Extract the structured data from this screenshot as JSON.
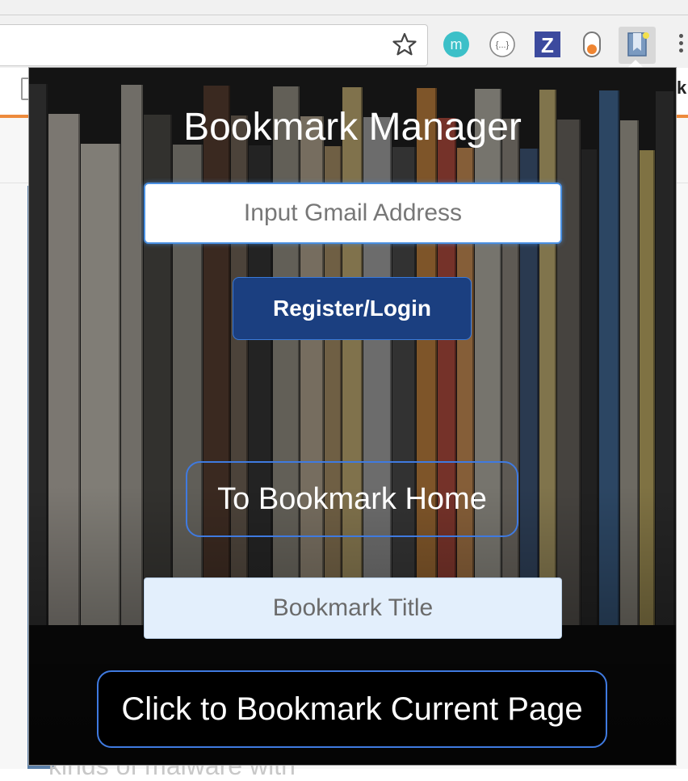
{
  "popup": {
    "title": "Bookmark Manager",
    "email_input": {
      "placeholder": "Input Gmail Address",
      "value": ""
    },
    "register_button": "Register/Login",
    "home_button": "To Bookmark Home",
    "bookmark_title_input": {
      "placeholder": "Bookmark Title",
      "value": ""
    },
    "bookmark_current_button": "Click to Bookmark Current Page"
  },
  "browser": {
    "page_letter": "k",
    "page_text": "kinds of malware with",
    "extensions": [
      "m-icon",
      "json-viewer-icon",
      "z-icon",
      "pill-icon",
      "bookmark-manager-icon"
    ],
    "colors": {
      "tab_accent": "#ed8a3c",
      "primary_button": "#1b3f80",
      "outline_blue": "#3f7ae0"
    }
  }
}
